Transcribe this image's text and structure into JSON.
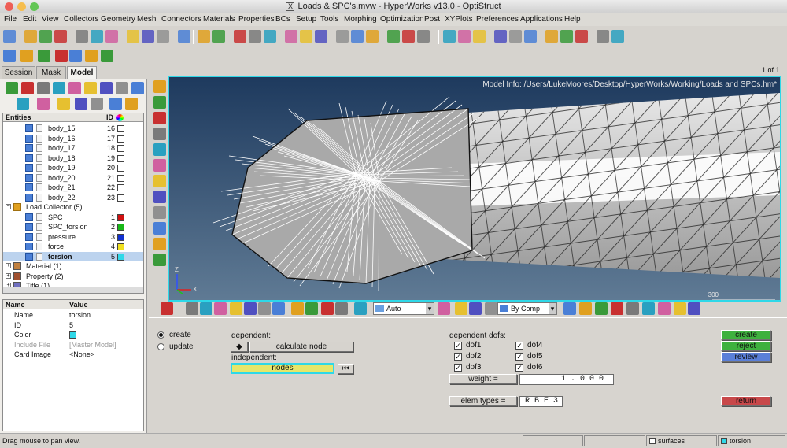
{
  "window": {
    "title": "Loads & SPC's.mvw - HyperWorks v13.0 - OptiStruct"
  },
  "menu": [
    "File",
    "Edit",
    "View",
    "Collectors",
    "Geometry",
    "Mesh",
    "Connectors",
    "Materials",
    "Properties",
    "BCs",
    "Setup",
    "Tools",
    "Morphing",
    "Optimization",
    "Post",
    "XYPlots",
    "Preferences",
    "Applications",
    "Help"
  ],
  "tabs": [
    "Session",
    "Mask",
    "Model"
  ],
  "page_counter": "1 of 1",
  "model_info": "Model Info: /Users/LukeMoores/Desktop/HyperWorks/Working/Loads and SPCs.hm*",
  "scale_label": "300",
  "entities": {
    "header_name": "Entities",
    "header_id": "ID",
    "bodies": [
      {
        "name": "body_15",
        "id": "16"
      },
      {
        "name": "body_16",
        "id": "17"
      },
      {
        "name": "body_17",
        "id": "18"
      },
      {
        "name": "body_18",
        "id": "19"
      },
      {
        "name": "body_19",
        "id": "20"
      },
      {
        "name": "body_20",
        "id": "21"
      },
      {
        "name": "body_21",
        "id": "22"
      },
      {
        "name": "body_22",
        "id": "23"
      }
    ],
    "load_collector": "Load Collector (5)",
    "loads": [
      {
        "name": "SPC",
        "id": "1",
        "color": "#d01010"
      },
      {
        "name": "SPC_torsion",
        "id": "2",
        "color": "#18b818"
      },
      {
        "name": "pressure",
        "id": "3",
        "color": "#1030d0"
      },
      {
        "name": "force",
        "id": "4",
        "color": "#f0e020"
      },
      {
        "name": "torsion",
        "id": "5",
        "color": "#30d8e8"
      }
    ],
    "material": "Material (1)",
    "property": "Property (2)",
    "title": "Title (1)"
  },
  "props": {
    "header_name": "Name",
    "header_value": "Value",
    "rows": [
      {
        "name": "Name",
        "value": "torsion"
      },
      {
        "name": "ID",
        "value": "5"
      },
      {
        "name": "Color",
        "value": ""
      },
      {
        "name": "Include File",
        "value": "[Master Model]"
      },
      {
        "name": "Card Image",
        "value": "<None>"
      }
    ]
  },
  "viewtools": {
    "auto_label": "Auto",
    "bycomp_label": "By Comp"
  },
  "panel": {
    "create_radio": "create",
    "update_radio": "update",
    "dependent_label": "dependent:",
    "calculate_node": "calculate node",
    "independent_label": "independent:",
    "nodes": "nodes",
    "dofs_label": "dependent dofs:",
    "dofs": [
      "dof1",
      "dof2",
      "dof3",
      "dof4",
      "dof5",
      "dof6"
    ],
    "weight_label": "weight =",
    "weight_value": "1.000",
    "elem_types_label": "elem types =",
    "elem_types_value": "RBE3",
    "create_btn": "create",
    "reject_btn": "reject",
    "review_btn": "review",
    "return_btn": "return"
  },
  "status": {
    "message": "Drag mouse to pan view.",
    "surfaces": "surfaces",
    "torsion": "torsion"
  },
  "colors": {
    "viewport_border": "#2ed8e8",
    "create": "#3eb13e",
    "review": "#5a7fd8",
    "return": "#c8484a",
    "nodes_field": "#e6e66a"
  }
}
